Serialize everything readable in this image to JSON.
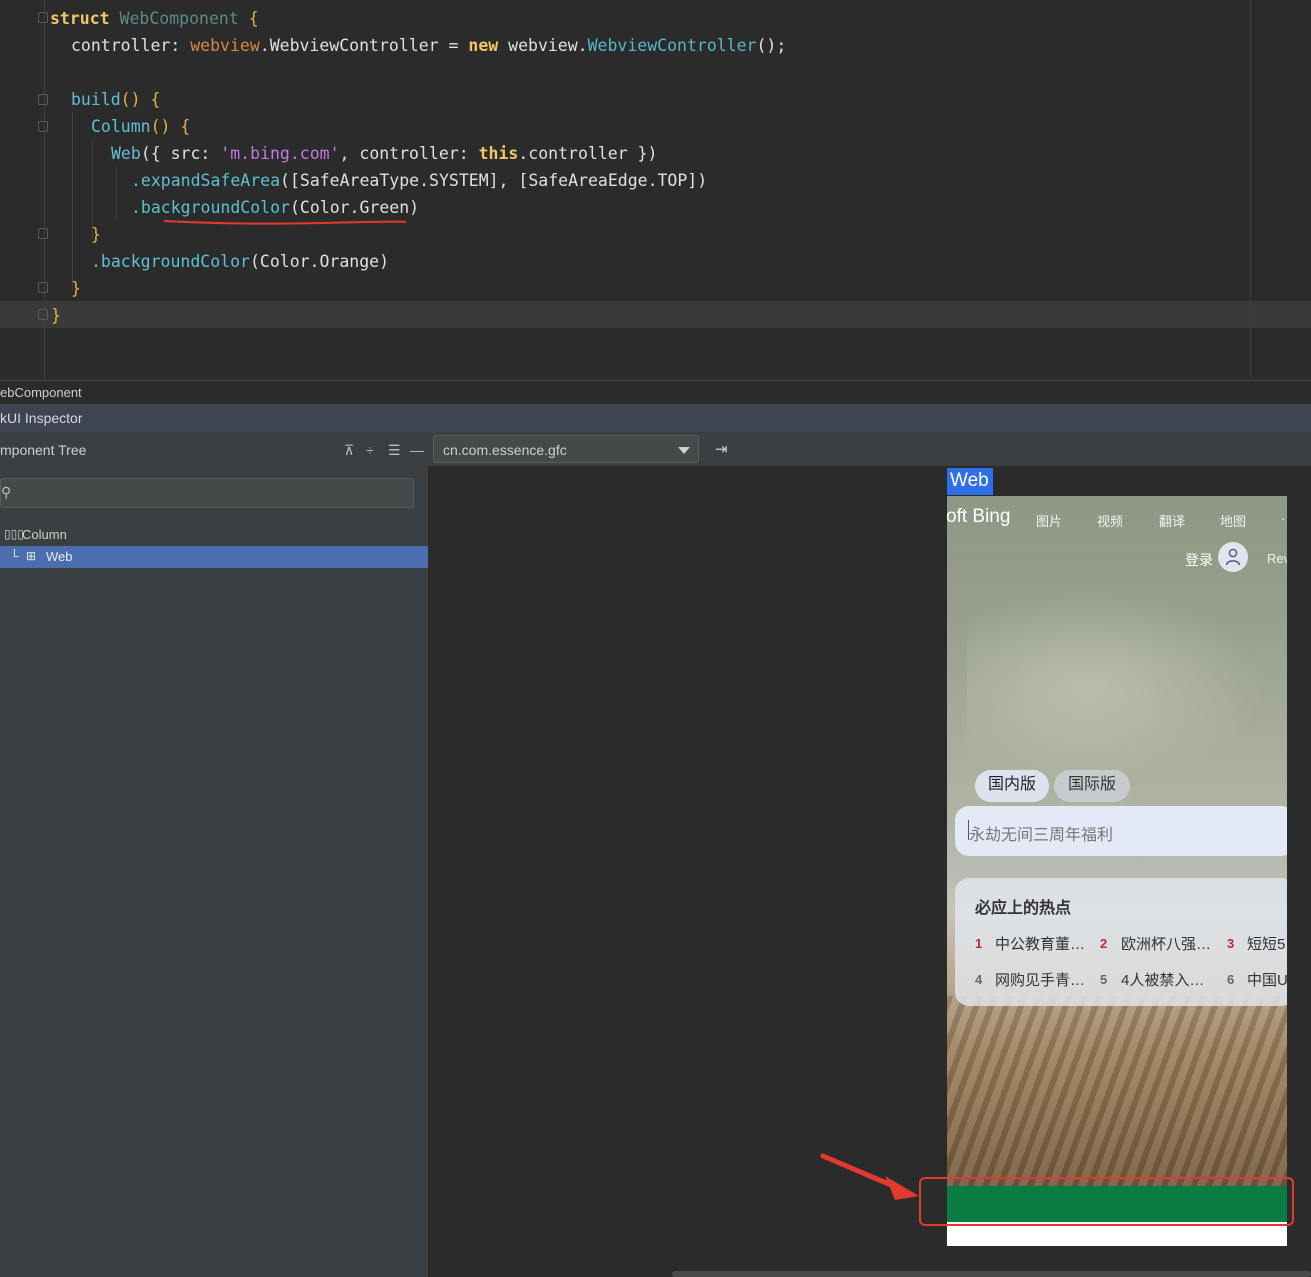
{
  "editor": {
    "lines": {
      "l1_kw": "struct",
      "l1_name": "WebComponent",
      "l1_brace": "{",
      "l2_field": "controller:",
      "l2_ns": "webview",
      "l2_type": ".WebviewController",
      "l2_eq": " = ",
      "l2_new": "new",
      "l2_ns2": " webview.",
      "l2_ctor": "WebviewController",
      "l2_end": "();",
      "l4_fn": "build",
      "l4_end": "() {",
      "l5_fn": "Column",
      "l5_end": "() {",
      "l6_fn": "Web",
      "l6_a": "({ src: ",
      "l6_str": "'m.bing.com'",
      "l6_b": ", controller: ",
      "l6_this": "this",
      "l6_c": ".controller })",
      "l7_fn": ".expandSafeArea",
      "l7_args": "([SafeAreaType.SYSTEM], [SafeAreaEdge.TOP])",
      "l8_fn": ".backgroundColor",
      "l8_args": "(Color.Green)",
      "l9": "}",
      "l10_fn": ".backgroundColor",
      "l10_args": "(Color.Orange)",
      "l11": "}",
      "l12": "}"
    }
  },
  "inspector": {
    "tab_label": "ebComponent",
    "title": "kUI Inspector",
    "tree_header": "mponent Tree",
    "toolbar_icons": [
      "expand-all-icon",
      "collapse-all-icon",
      "list-icon",
      "minus-icon"
    ],
    "search_placeholder": "",
    "tree": [
      {
        "label": "Column",
        "selected": false
      },
      {
        "label": "Web",
        "selected": true
      }
    ],
    "app_select_value": "cn.com.essence.gfc",
    "selection_color": "#4b6eaf"
  },
  "preview": {
    "web_label": "Web",
    "brand": "oft Bing",
    "nav": [
      "图片",
      "视频",
      "翻译",
      "地图",
      "·"
    ],
    "login": "登录",
    "rewards": "Rev",
    "pills": [
      "国内版",
      "国际版"
    ],
    "search_text": "永劫无间三周年福利",
    "hot_title": "必应上的热点",
    "hot_items": [
      {
        "num": "1",
        "text": "中公教育董…"
      },
      {
        "num": "2",
        "text": "欧洲杯八强…"
      },
      {
        "num": "3",
        "text": "短短5"
      },
      {
        "num": "4",
        "text": "网购见手青…"
      },
      {
        "num": "5",
        "text": "4人被禁入…"
      },
      {
        "num": "6",
        "text": "中国U"
      }
    ],
    "green_bar_color": "#0b7d43",
    "annotation_color": "#e23b2e"
  }
}
